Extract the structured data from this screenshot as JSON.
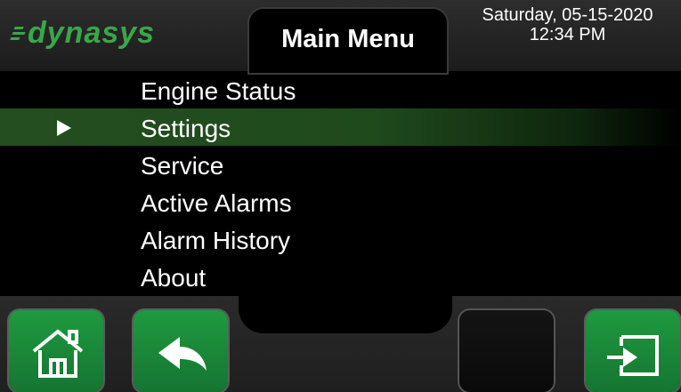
{
  "header": {
    "logo_text": "dynasys",
    "title": "Main Menu",
    "date": "Saturday, 05-15-2020",
    "time": "12:34 PM"
  },
  "menu": {
    "items": [
      {
        "label": "Engine Status"
      },
      {
        "label": "Settings",
        "selected": true
      },
      {
        "label": "Service"
      },
      {
        "label": "Active Alarms"
      },
      {
        "label": "Alarm History"
      },
      {
        "label": "About"
      }
    ]
  },
  "footer": {
    "buttons": [
      {
        "icon": "home-icon"
      },
      {
        "icon": "back-arrow-icon"
      },
      {
        "icon": "none"
      },
      {
        "icon": "enter-icon"
      }
    ]
  },
  "colors": {
    "accent_green": "#1f9a3f",
    "selection_green": "#244e1f",
    "logo_green": "#3aa64a"
  }
}
